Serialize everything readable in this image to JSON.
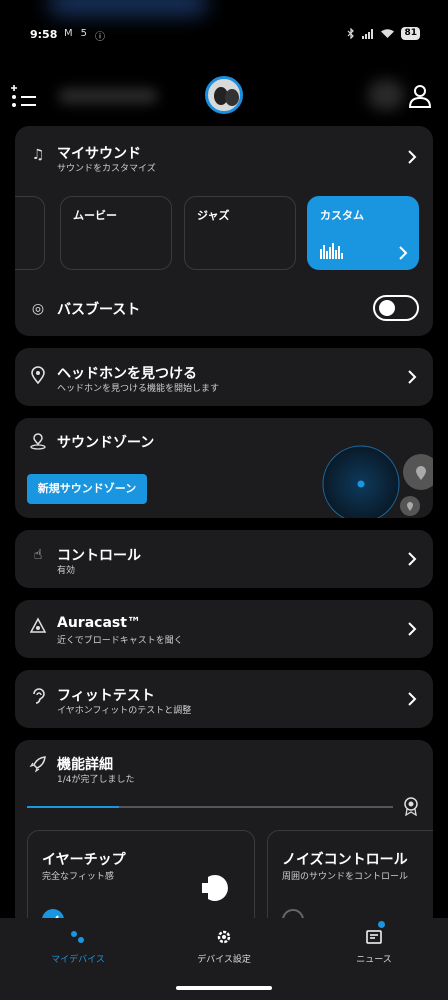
{
  "status_bar": {
    "time": "9:58",
    "left_icons": [
      "M",
      "5",
      "ⓘ"
    ],
    "right_icons": [
      "bluetooth-icon",
      "signal-icon",
      "wifi-icon"
    ],
    "battery": "81"
  },
  "header": {
    "device_image": "headphone-earbuds-image",
    "menu_icon": "menu-add-icon",
    "profile_icon": "user-icon"
  },
  "my_sound": {
    "title": "マイサウンド",
    "subtitle": "サウンドをカスタマイズ",
    "presets": [
      {
        "label": ""
      },
      {
        "label": "ムービー"
      },
      {
        "label": "ジャズ"
      },
      {
        "label": "カスタム"
      }
    ],
    "bass_boost_label": "バスブースト",
    "bass_boost_on": false
  },
  "find_headphones": {
    "title": "ヘッドホンを見つける",
    "subtitle": "ヘッドホンを見つける機能を開始します"
  },
  "sound_zone": {
    "title": "サウンドゾーン",
    "button_label": "新規サウンドゾーン"
  },
  "controls": {
    "title": "コントロール",
    "subtitle": "有効"
  },
  "auracast": {
    "title": "Auracast™",
    "subtitle": "近くでブロードキャストを聞く"
  },
  "fit_test": {
    "title": "フィットテスト",
    "subtitle": "イヤホンフィットのテストと調整"
  },
  "features": {
    "title": "機能詳細",
    "subtitle": "1/4が完了しました",
    "progress": 0.25,
    "cards": [
      {
        "title": "イヤーチップ",
        "subtitle": "完全なフィット感",
        "done": true
      },
      {
        "title": "ノイズコントロール",
        "subtitle": "周囲のサウンドをコントロール",
        "done": false
      }
    ]
  },
  "bottom_nav": {
    "items": [
      {
        "label": "マイデバイス",
        "icon": "device-icon",
        "active": true
      },
      {
        "label": "デバイス設定",
        "icon": "gear-icon",
        "active": false
      },
      {
        "label": "ニュース",
        "icon": "news-icon",
        "active": false
      }
    ]
  },
  "colors": {
    "accent": "#1a95e0",
    "card": "#1c1c1e",
    "background": "#000000"
  }
}
